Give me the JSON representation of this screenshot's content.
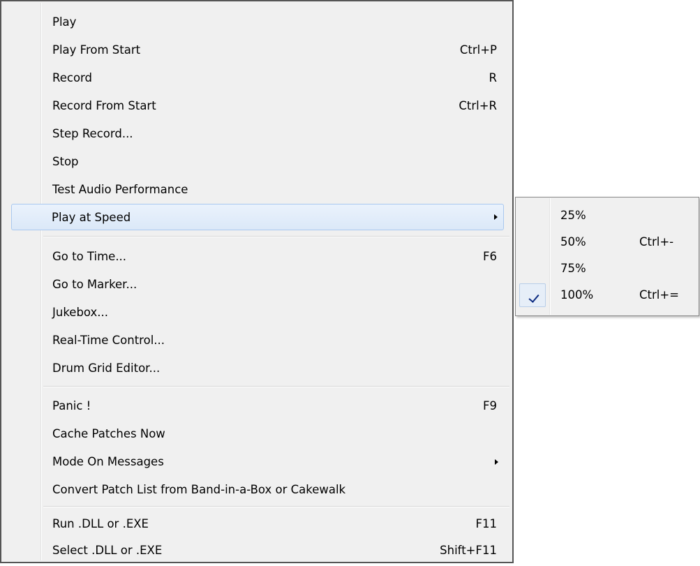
{
  "menu": {
    "items": [
      {
        "label": "Play",
        "shortcut": ""
      },
      {
        "label": "Play From Start",
        "shortcut": "Ctrl+P"
      },
      {
        "label": "Record",
        "shortcut": "R"
      },
      {
        "label": "Record From Start",
        "shortcut": "Ctrl+R"
      },
      {
        "label": "Step Record...",
        "shortcut": ""
      },
      {
        "label": "Stop",
        "shortcut": ""
      },
      {
        "label": "Test Audio Performance",
        "shortcut": ""
      },
      {
        "label": "Play at Speed",
        "shortcut": "",
        "has_submenu": true,
        "highlighted": true
      },
      {
        "label": "Go to Time...",
        "shortcut": "F6"
      },
      {
        "label": "Go to Marker...",
        "shortcut": ""
      },
      {
        "label": "Jukebox...",
        "shortcut": ""
      },
      {
        "label": "Real-Time Control...",
        "shortcut": ""
      },
      {
        "label": "Drum Grid Editor...",
        "shortcut": ""
      },
      {
        "label": "Panic !",
        "shortcut": "F9"
      },
      {
        "label": "Cache Patches Now",
        "shortcut": ""
      },
      {
        "label": "Mode On Messages",
        "shortcut": "",
        "has_submenu": true
      },
      {
        "label": "Convert Patch List from Band-in-a-Box or Cakewalk",
        "shortcut": ""
      },
      {
        "label": "Run .DLL or .EXE",
        "shortcut": "F11"
      },
      {
        "label": "Select .DLL or .EXE",
        "shortcut": "Shift+F11"
      }
    ]
  },
  "submenu": {
    "items": [
      {
        "label": "25%",
        "shortcut": "",
        "checked": false
      },
      {
        "label": "50%",
        "shortcut": "Ctrl+-",
        "checked": false
      },
      {
        "label": "75%",
        "shortcut": "",
        "checked": false
      },
      {
        "label": "100%",
        "shortcut": "Ctrl+=",
        "checked": true
      }
    ]
  },
  "colors": {
    "menu_background": "#f0f0f0",
    "highlight_border": "#a9c8ef",
    "check_mark": "#0b2a80"
  },
  "icons": {
    "submenu_arrow": "chevron-right-icon",
    "checked": "check-icon"
  }
}
